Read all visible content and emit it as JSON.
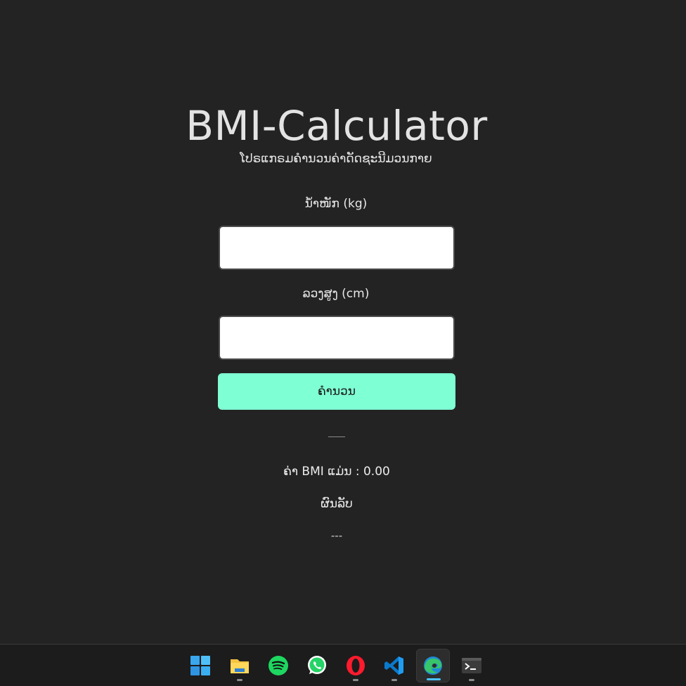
{
  "app": {
    "title": "BMI-Calculator",
    "subtitle": "ໂປຣແກຣມຄຳນວນຄ່າດັດຊະນີມວນກາຍ"
  },
  "form": {
    "weight_label": "ນ້ຳໜັກ (kg)",
    "weight_value": "",
    "height_label": "ລວງສູງ (cm)",
    "height_value": "",
    "calculate_label": "ຄຳນວນ",
    "button_color": "#7fffd4"
  },
  "result": {
    "bmi_text": "ຄ່າ BMI ແມ່ນ : 0.00",
    "outcome_label": "ຜົນລັບ",
    "outcome_value": "---"
  },
  "taskbar": {
    "items": [
      {
        "name": "windows-start-icon"
      },
      {
        "name": "file-explorer-icon"
      },
      {
        "name": "spotify-icon"
      },
      {
        "name": "whatsapp-icon"
      },
      {
        "name": "opera-icon"
      },
      {
        "name": "vscode-icon"
      },
      {
        "name": "edge-icon"
      },
      {
        "name": "terminal-icon"
      }
    ],
    "accent_color": "#4cc2ff"
  }
}
